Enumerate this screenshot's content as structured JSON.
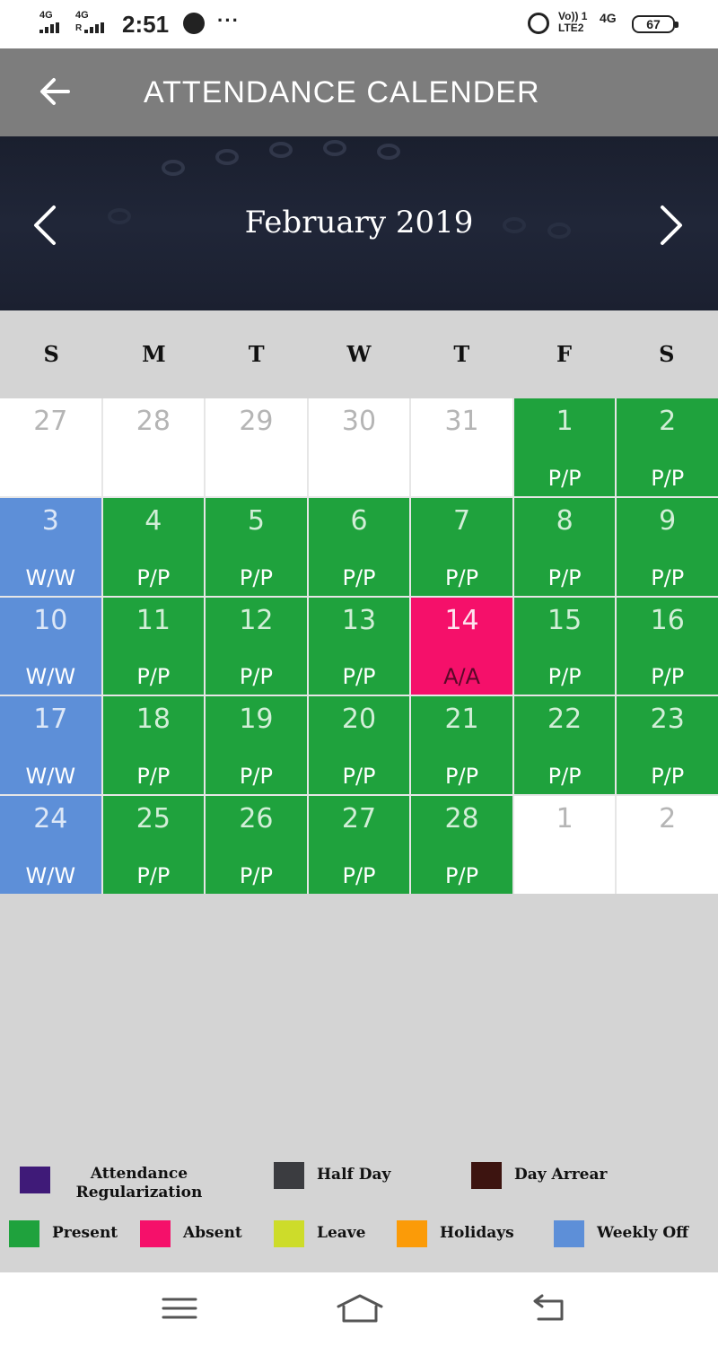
{
  "status_bar": {
    "time": "2:51",
    "sim1": "4G",
    "sim2": "4G",
    "sim2_roaming": "R",
    "more": "···",
    "volte_top": "Vo)) 1",
    "volte_bottom": "LTE2",
    "network": "4G",
    "battery": "67"
  },
  "app_bar": {
    "title": "ATTENDANCE CALENDER",
    "back_icon": "arrow-left-icon"
  },
  "month_header": {
    "month": "February 2019",
    "prev_icon": "chevron-left-icon",
    "next_icon": "chevron-right-icon"
  },
  "weekdays": [
    "S",
    "M",
    "T",
    "W",
    "T",
    "F",
    "S"
  ],
  "calendar": {
    "rows": [
      [
        {
          "day": "27",
          "code": "",
          "status": "out"
        },
        {
          "day": "28",
          "code": "",
          "status": "out"
        },
        {
          "day": "29",
          "code": "",
          "status": "out"
        },
        {
          "day": "30",
          "code": "",
          "status": "out"
        },
        {
          "day": "31",
          "code": "",
          "status": "out"
        },
        {
          "day": "1",
          "code": "P/P",
          "status": "present"
        },
        {
          "day": "2",
          "code": "P/P",
          "status": "present"
        }
      ],
      [
        {
          "day": "3",
          "code": "W/W",
          "status": "weekly"
        },
        {
          "day": "4",
          "code": "P/P",
          "status": "present"
        },
        {
          "day": "5",
          "code": "P/P",
          "status": "present"
        },
        {
          "day": "6",
          "code": "P/P",
          "status": "present"
        },
        {
          "day": "7",
          "code": "P/P",
          "status": "present"
        },
        {
          "day": "8",
          "code": "P/P",
          "status": "present"
        },
        {
          "day": "9",
          "code": "P/P",
          "status": "present"
        }
      ],
      [
        {
          "day": "10",
          "code": "W/W",
          "status": "weekly"
        },
        {
          "day": "11",
          "code": "P/P",
          "status": "present"
        },
        {
          "day": "12",
          "code": "P/P",
          "status": "present"
        },
        {
          "day": "13",
          "code": "P/P",
          "status": "present"
        },
        {
          "day": "14",
          "code": "A/A",
          "status": "absent"
        },
        {
          "day": "15",
          "code": "P/P",
          "status": "present"
        },
        {
          "day": "16",
          "code": "P/P",
          "status": "present"
        }
      ],
      [
        {
          "day": "17",
          "code": "W/W",
          "status": "weekly"
        },
        {
          "day": "18",
          "code": "P/P",
          "status": "present"
        },
        {
          "day": "19",
          "code": "P/P",
          "status": "present"
        },
        {
          "day": "20",
          "code": "P/P",
          "status": "present"
        },
        {
          "day": "21",
          "code": "P/P",
          "status": "present"
        },
        {
          "day": "22",
          "code": "P/P",
          "status": "present"
        },
        {
          "day": "23",
          "code": "P/P",
          "status": "present"
        }
      ],
      [
        {
          "day": "24",
          "code": "W/W",
          "status": "weekly"
        },
        {
          "day": "25",
          "code": "P/P",
          "status": "present"
        },
        {
          "day": "26",
          "code": "P/P",
          "status": "present"
        },
        {
          "day": "27",
          "code": "P/P",
          "status": "present"
        },
        {
          "day": "28",
          "code": "P/P",
          "status": "present"
        },
        {
          "day": "1",
          "code": "",
          "status": "out"
        },
        {
          "day": "2",
          "code": "",
          "status": "out"
        }
      ]
    ]
  },
  "legend": [
    {
      "label": "Attendance Regularization",
      "color": "#3f1a78"
    },
    {
      "label": "Half Day",
      "color": "#3b3c40"
    },
    {
      "label": "Day Arrear",
      "color": "#3d1410"
    },
    {
      "label": "Present",
      "color": "#1fa23d"
    },
    {
      "label": "Absent",
      "color": "#f5106a"
    },
    {
      "label": "Leave",
      "color": "#cddc2a"
    },
    {
      "label": "Holidays",
      "color": "#fb9b08"
    },
    {
      "label": "Weekly Off",
      "color": "#5d8fd8"
    }
  ],
  "nav_bar": {
    "menu_icon": "menu-icon",
    "home_icon": "home-icon",
    "back_icon": "back-icon"
  }
}
